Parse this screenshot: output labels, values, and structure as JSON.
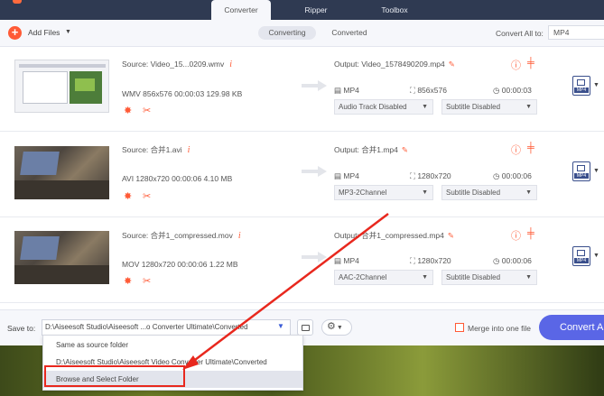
{
  "tabs": [
    {
      "label": "Converter",
      "active": true
    },
    {
      "label": "Ripper",
      "active": false
    },
    {
      "label": "Toolbox",
      "active": false
    }
  ],
  "toolbar": {
    "add_files_label": "Add Files",
    "segment_converting": "Converting",
    "segment_converted": "Converted",
    "convert_all_to_label": "Convert All to:",
    "convert_all_to_value": "MP4"
  },
  "files": [
    {
      "source": "Source: Video_15...0209.wmv",
      "meta": "WMV  856x576  00:00:03  129.98 KB",
      "output": "Output: Video_1578490209.mp4",
      "format": "MP4",
      "resolution": "856x576",
      "duration": "00:00:03",
      "audio_track": "Audio Track Disabled",
      "subtitle": "Subtitle Disabled",
      "badge": "MP4"
    },
    {
      "source": "Source: 合并1.avi",
      "meta": "AVI  1280x720  00:00:06  4.10 MB",
      "output": "Output: 合并1.mp4",
      "format": "MP4",
      "resolution": "1280x720",
      "duration": "00:00:06",
      "audio_track": "MP3-2Channel",
      "subtitle": "Subtitle Disabled",
      "badge": "MP4"
    },
    {
      "source": "Source: 合并1_compressed.mov",
      "meta": "MOV  1280x720  00:00:06  1.22 MB",
      "output": "Output: 合并1_compressed.mp4",
      "format": "MP4",
      "resolution": "1280x720",
      "duration": "00:00:06",
      "audio_track": "AAC-2Channel",
      "subtitle": "Subtitle Disabled",
      "badge": "MP4"
    }
  ],
  "bottom": {
    "save_to_label": "Save to:",
    "save_path": "D:\\Aiseesoft Studio\\Aiseesoft ...o Converter Ultimate\\Converted",
    "merge_label": "Merge into one file",
    "convert_all_button": "Convert All"
  },
  "dropdown": {
    "items": [
      "Same as source folder",
      "D:\\Aiseesoft Studio\\Aiseesoft Video Converter Ultimate\\Converted",
      "Browse and Select Folder"
    ],
    "highlighted_index": 2
  },
  "colors": {
    "accent": "#ff5a36",
    "primary_button": "#5a66e6",
    "topbar": "#2f3a52",
    "annotation": "#e8281e"
  }
}
